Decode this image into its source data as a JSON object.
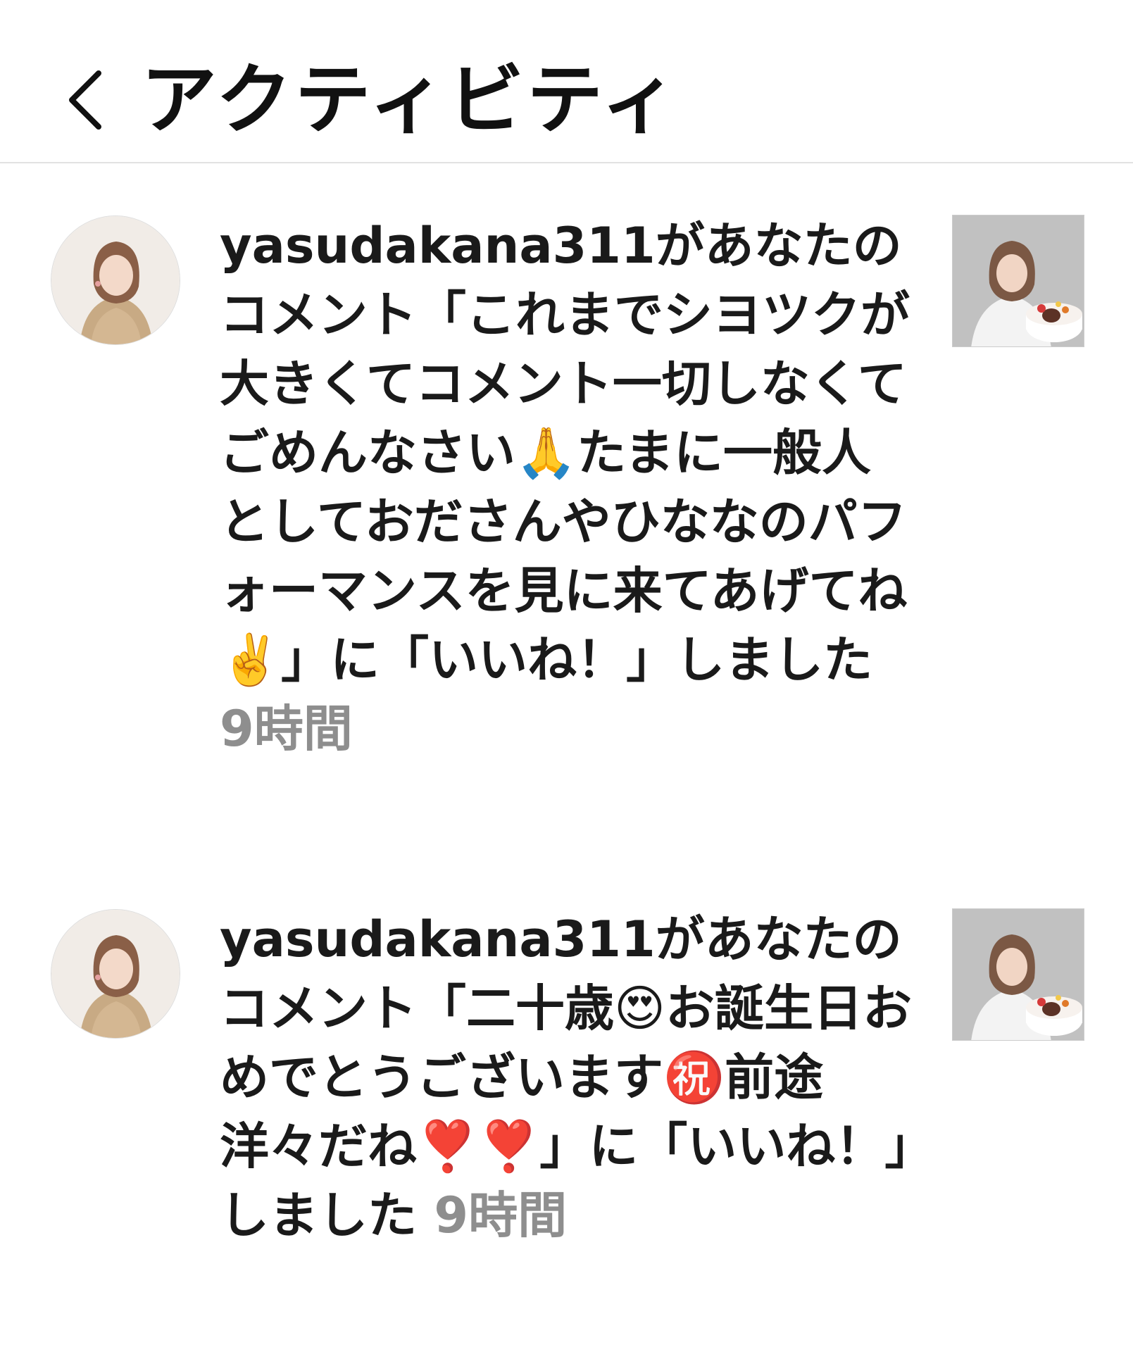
{
  "header": {
    "title": "アクティビティ",
    "back_icon": "chevron-left-icon"
  },
  "activities": [
    {
      "username": "yasudakana311",
      "message": "があなたのコメント「これまでシヨツクが大きくてコメント一切しなくてごめんなさい🙏たまに一般人としておださんやひななのパフォーマンスを見に来てあげてね✌️」に「いいね！」しました",
      "time": "9時間"
    },
    {
      "username": "yasudakana311",
      "message": "があなたのコメント「二十歳😍お誕生日おめでとうございます㊗️前途洋々だね❣️❣️」に「いいね！」しました",
      "time": "9時間"
    }
  ],
  "colors": {
    "text": "#1a1a1a",
    "timestamp": "#8e8e8e",
    "divider": "#e2e2e2",
    "background": "#ffffff"
  }
}
